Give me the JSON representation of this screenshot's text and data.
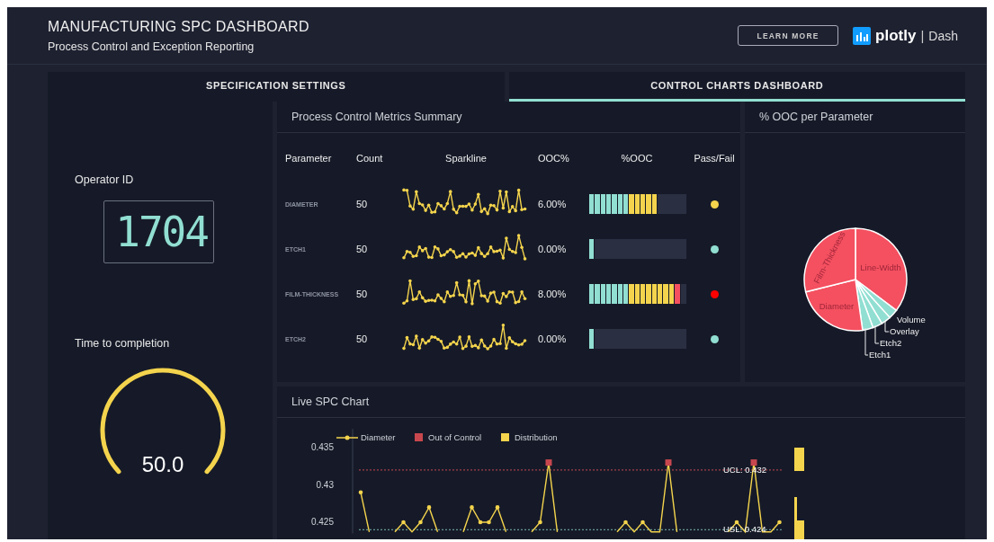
{
  "header": {
    "title": "MANUFACTURING SPC DASHBOARD",
    "subtitle": "Process Control and Exception Reporting",
    "button": "LEARN MORE",
    "brand": {
      "name": "plotly",
      "separator": "|",
      "product": "Dash"
    }
  },
  "tabs": [
    {
      "label": "SPECIFICATION SETTINGS",
      "selected": false
    },
    {
      "label": "CONTROL CHARTS DASHBOARD",
      "selected": true
    }
  ],
  "operator": {
    "label": "Operator ID",
    "value": "1704"
  },
  "completion": {
    "label": "Time to completion",
    "value": "50.0"
  },
  "metrics": {
    "title": "Process Control Metrics Summary",
    "columns": [
      "Parameter",
      "Count",
      "Sparkline",
      "OOC%",
      "%OOC",
      "Pass/Fail"
    ],
    "rows": [
      {
        "parameter": "DIAMETER",
        "count": "50",
        "ooc_percent": "6.00%",
        "color": "#f4d44d",
        "segments": [
          {
            "color": "#91dfd2"
          },
          {
            "color": "#91dfd2"
          },
          {
            "color": "#91dfd2"
          },
          {
            "color": "#91dfd2"
          },
          {
            "color": "#91dfd2"
          },
          {
            "color": "#91dfd2"
          },
          {
            "color": "#91dfd2"
          },
          {
            "color": "#f4d44d"
          },
          {
            "color": "#f4d44d"
          },
          {
            "color": "#f4d44d"
          },
          {
            "color": "#f4d44d"
          },
          {
            "color": "#f4d44d"
          }
        ]
      },
      {
        "parameter": "ETCH1",
        "count": "50",
        "ooc_percent": "0.00%",
        "color": "#91dfd2",
        "segments": [
          {
            "color": "#91dfd2"
          }
        ]
      },
      {
        "parameter": "FILM-THICKNESS",
        "count": "50",
        "ooc_percent": "8.00%",
        "color": "#ff0000",
        "segments": [
          {
            "color": "#91dfd2"
          },
          {
            "color": "#91dfd2"
          },
          {
            "color": "#91dfd2"
          },
          {
            "color": "#91dfd2"
          },
          {
            "color": "#91dfd2"
          },
          {
            "color": "#91dfd2"
          },
          {
            "color": "#91dfd2"
          },
          {
            "color": "#f4d44d"
          },
          {
            "color": "#f4d44d"
          },
          {
            "color": "#f4d44d"
          },
          {
            "color": "#f4d44d"
          },
          {
            "color": "#f4d44d"
          },
          {
            "color": "#f4d44d"
          },
          {
            "color": "#f4d44d"
          },
          {
            "color": "#f4d44d"
          },
          {
            "color": "#f45060"
          }
        ]
      },
      {
        "parameter": "ETCH2",
        "count": "50",
        "ooc_percent": "0.00%",
        "color": "#91dfd2",
        "segments": [
          {
            "color": "#91dfd2"
          }
        ]
      }
    ]
  },
  "pie": {
    "title": "% OOC per Parameter",
    "slices": [
      {
        "label": "Line-Width",
        "color": "#f45060"
      },
      {
        "label": "Volume",
        "color": "#91dfd2"
      },
      {
        "label": "Overlay",
        "color": "#91dfd2"
      },
      {
        "label": "Etch2",
        "color": "#91dfd2"
      },
      {
        "label": "Etch1",
        "color": "#91dfd2"
      },
      {
        "label": "Diameter",
        "color": "#f45060"
      },
      {
        "label": "Film-Thickness",
        "color": "#f45060"
      }
    ]
  },
  "live_spc": {
    "title": "Live SPC Chart",
    "legend_extra": [
      {
        "label": "Out of Control",
        "color": "#c8474e",
        "kind": "marker"
      },
      {
        "label": "Distribution",
        "color": "#f4d44d",
        "kind": "bar"
      }
    ],
    "chart_data": {
      "type": "line",
      "ylim": [
        0.4235,
        0.4375
      ],
      "yticks": [
        0.425,
        0.43,
        0.435
      ],
      "series": [
        {
          "name": "Diameter",
          "color": "#f4d44d",
          "values": [
            0.429,
            0.4237,
            null,
            null,
            0.4237,
            0.425,
            0.4237,
            0.425,
            0.427,
            0.4237,
            null,
            null,
            0.4237,
            0.427,
            0.425,
            0.425,
            0.427,
            0.4237,
            null,
            null,
            0.4237,
            0.425,
            0.433,
            0.4237,
            null,
            null,
            null,
            null,
            null,
            null,
            0.4237,
            0.425,
            0.4237,
            0.425,
            0.4237,
            0.4237,
            0.433,
            0.4237,
            null,
            null,
            null,
            null,
            null,
            0.4237,
            0.425,
            0.4237,
            0.433,
            0.4237,
            0.4237,
            0.425
          ]
        }
      ],
      "ref_lines": [
        {
          "axis": "y",
          "value": 0.432,
          "label": "UCL: 0.432",
          "color": "#f45060"
        },
        {
          "axis": "y",
          "value": 0.424,
          "label": "USL: 0.424",
          "color": "#91dfd2"
        }
      ]
    }
  }
}
